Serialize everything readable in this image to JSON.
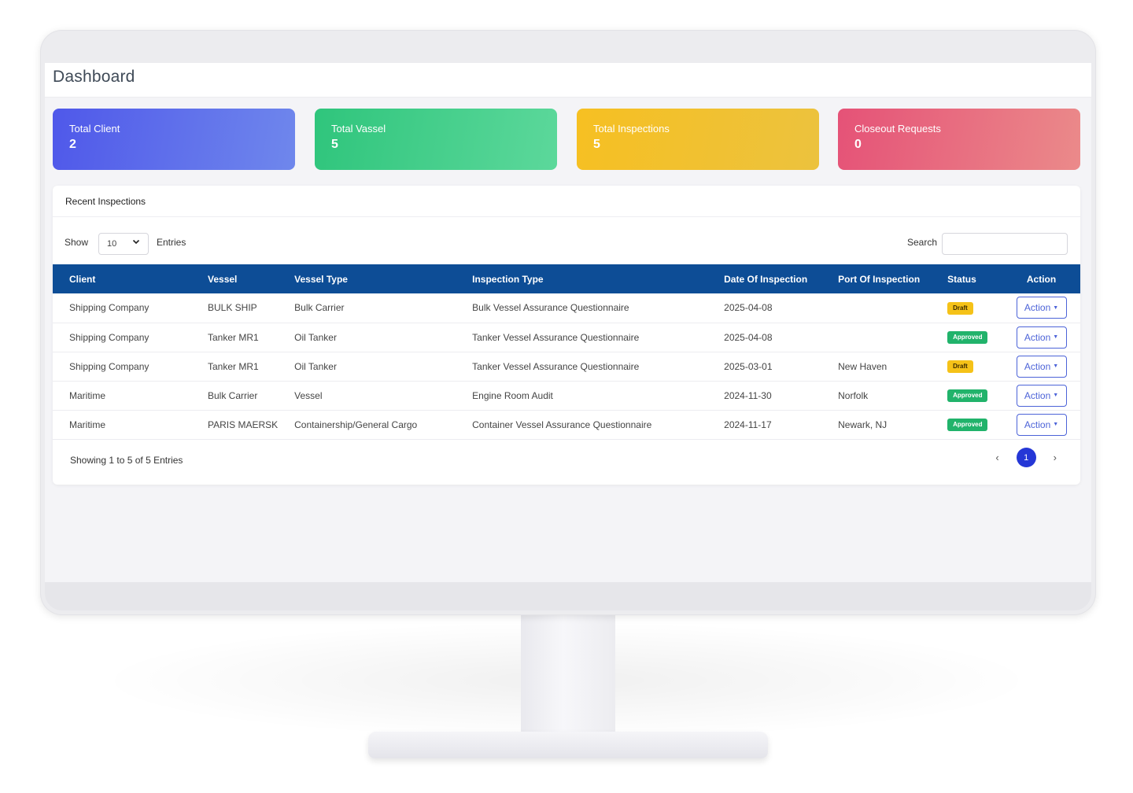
{
  "header": {
    "title": "Dashboard"
  },
  "stats": [
    {
      "label": "Total Client",
      "value": "2"
    },
    {
      "label": "Total Vassel",
      "value": "5"
    },
    {
      "label": "Total Inspections",
      "value": "5"
    },
    {
      "label": "Closeout Requests",
      "value": "0"
    }
  ],
  "panel": {
    "title": "Recent Inspections",
    "show_label": "Show",
    "entries_value": "10",
    "entries_label": "Entries",
    "search_label": "Search",
    "search_value": ""
  },
  "table": {
    "columns": [
      "Client",
      "Vessel",
      "Vessel Type",
      "Inspection Type",
      "Date Of Inspection",
      "Port Of Inspection",
      "Status",
      "Action"
    ],
    "rows": [
      {
        "client": "Shipping Company",
        "vessel": "BULK SHIP",
        "vessel_type": "Bulk Carrier",
        "inspection_type": "Bulk Vessel Assurance Questionnaire",
        "date": "2025-04-08",
        "port": "",
        "status": "Draft",
        "action": "Action"
      },
      {
        "client": "Shipping Company",
        "vessel": "Tanker MR1",
        "vessel_type": "Oil Tanker",
        "inspection_type": "Tanker Vessel Assurance Questionnaire",
        "date": "2025-04-08",
        "port": "",
        "status": "Approved",
        "action": "Action"
      },
      {
        "client": "Shipping Company",
        "vessel": "Tanker MR1",
        "vessel_type": "Oil Tanker",
        "inspection_type": "Tanker Vessel Assurance Questionnaire",
        "date": "2025-03-01",
        "port": "New Haven",
        "status": "Draft",
        "action": "Action"
      },
      {
        "client": "Maritime",
        "vessel": "Bulk Carrier",
        "vessel_type": "Vessel",
        "inspection_type": "Engine Room Audit",
        "date": "2024-11-30",
        "port": "Norfolk",
        "status": "Approved",
        "action": "Action"
      },
      {
        "client": "Maritime",
        "vessel": "PARIS MAERSK",
        "vessel_type": "Containership/General Cargo",
        "inspection_type": "Container Vessel Assurance Questionnaire",
        "date": "2024-11-17",
        "port": "Newark, NJ",
        "status": "Approved",
        "action": "Action"
      }
    ]
  },
  "footer": {
    "info": "Showing 1 to 5 of 5 Entries",
    "prev": "‹",
    "current_page": "1",
    "next": "›"
  },
  "colors": {
    "table_header": "#0d4d96",
    "card_client": "#4f58ea",
    "card_vessel": "#2fc57c",
    "card_inspections": "#f6c022",
    "card_closeout": "#e55277",
    "draft": "#f5c218",
    "approved": "#21b36b",
    "accent": "#2537d6"
  }
}
